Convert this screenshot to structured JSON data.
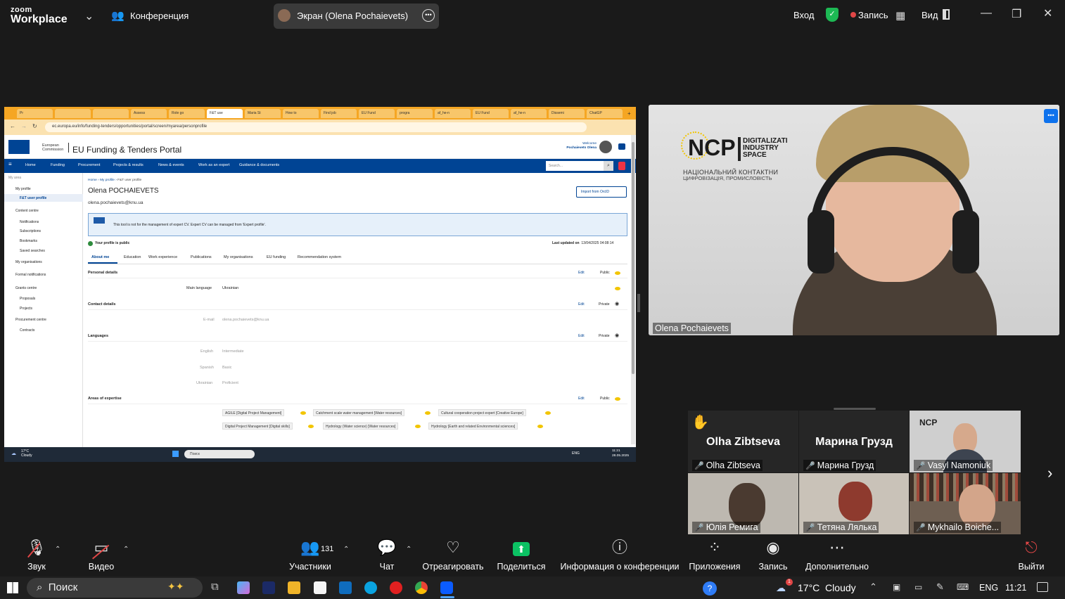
{
  "topbar": {
    "brand_line1": "zoom",
    "brand_line2": "Workplace",
    "meeting_label": "Конференция",
    "screen_share_label": "Экран (Olena Pochaievets)",
    "signin_label": "Вход",
    "record_label": "Запись",
    "view_label": "Вид"
  },
  "browser": {
    "tabs": [
      "Pr",
      "",
      "",
      "Assess",
      "Role go",
      "F&T use",
      "Maria St",
      "How to",
      "Find job",
      "EU Fund",
      "progra",
      "af_he-n",
      "EU Fund",
      "af_he-n",
      "Dissemi",
      "ChatGP"
    ],
    "url": "ec.europa.eu/info/funding-tenders/opportunities/portal/screen/myarea/personprofile"
  },
  "portal": {
    "ec_label1": "European",
    "ec_label2": "Commission",
    "title": "EU Funding & Tenders Portal",
    "welcome": "Welcome",
    "welcome_name": "Pochaievets Olena",
    "nav": [
      "Home",
      "Funding",
      "Procurement",
      "Projects & results",
      "News & events",
      "Work as an expert",
      "Guidance & documents"
    ],
    "search_placeholder": "Search...",
    "sidebar": {
      "my_area": "My area",
      "my_profile": "My profile",
      "ft_user_profile": "F&T user profile",
      "content_centre": "Content centre",
      "notifications": "Notifications",
      "subscriptions": "Subscriptions",
      "bookmarks": "Bookmarks",
      "saved_searches": "Saved searches",
      "my_organisations": "My organisations",
      "formal_notifications": "Formal notifications",
      "grants_centre": "Grants centre",
      "proposals": "Proposals",
      "projects": "Projects",
      "procurement_centre": "Procurement centre",
      "contracts": "Contracts"
    },
    "breadcrumb": [
      "Home",
      "My profile",
      "F&T user profile"
    ],
    "profile_name": "Olena POCHAIEVETS",
    "profile_email": "olena.pochaievets@knu.ua",
    "import_button": "Import from OrcID",
    "info_text": "This tool is not for the management of expert CV. Expert CV can be managed from 'Expert profile'.",
    "public_status": "Your profile is public",
    "last_updated_label": "Last updated on",
    "last_updated_value": "13/04/2025 04:08:14",
    "tabs": [
      "About me",
      "Education",
      "Work experience",
      "Publications",
      "My organisations",
      "EU funding",
      "Recommendation system"
    ],
    "edit_label": "Edit",
    "public_label": "Public",
    "private_label": "Private",
    "personal_details": "Personal details",
    "main_language_label": "Main language",
    "main_language_value": "Ukrainian",
    "contact_details": "Contact details",
    "email_label": "E-mail",
    "email_value": "olena.pochaievets@knu.ua",
    "languages": "Languages",
    "lang_rows": [
      {
        "name": "English",
        "level": "Intermediate"
      },
      {
        "name": "Spanish",
        "level": "Basic"
      },
      {
        "name": "Ukrainian",
        "level": "Proficient"
      }
    ],
    "areas_of_expertise": "Areas of expertise",
    "expertise_tags": [
      "AGILE [Digital Project Management]",
      "Catchment scale water management [Water resources]",
      "Cultural cooperation project expert [Creative Europe]",
      "Digital Project Management [Digital skills]",
      "Hydrology (Water science) [Water resources]",
      "Hydrology [Earth and related Environmental sciences]"
    ]
  },
  "inner_taskbar": {
    "weather_temp": "17°C",
    "weather_desc": "Cloudy",
    "search": "Поиск",
    "lang": "ENG",
    "time": "11:21",
    "date": "28.05.2025"
  },
  "main_video": {
    "name": "Olena Pochaievets",
    "ncp_title": "NCP",
    "ncp_line1": "DIGITALIZATI",
    "ncp_line2": "INDUSTRY",
    "ncp_line3": "SPACE",
    "ncp_ua1": "НАЦІОНАЛЬНИЙ КОНТАКТНИ",
    "ncp_ua2": "ЦИФРОВІЗАЦІЯ, ПРОМИСЛОВІСТЬ"
  },
  "participants": [
    {
      "display": "Olha Zibtseva",
      "name": "Olha Zibtseva"
    },
    {
      "display": "Марина Грузд",
      "name": "Марина Грузд"
    },
    {
      "display": "",
      "name": "Vasyl Namoniuk"
    },
    {
      "display": "",
      "name": "Юлія Ремига"
    },
    {
      "display": "",
      "name": "Тетяна Лялька"
    },
    {
      "display": "",
      "name": "Mykhailo Boiche..."
    }
  ],
  "toolbar": {
    "audio": "Звук",
    "video": "Видео",
    "participants": "Участники",
    "participants_count": "131",
    "chat": "Чат",
    "react": "Отреагировать",
    "share": "Поделиться",
    "meeting_info": "Информация о конференции",
    "apps": "Приложения",
    "record": "Запись",
    "more": "Дополнительно",
    "leave": "Выйти"
  },
  "taskbar": {
    "search": "Поиск",
    "weather": "17°C  Cloudy",
    "lang": "ENG",
    "time": "11:21",
    "weather_badge": "1"
  },
  "colors": {
    "zoom_green": "#1db954",
    "record_red": "#e04646",
    "ec_blue": "#004494",
    "browser_orange": "#f5a623",
    "share_green": "#0bc263"
  }
}
